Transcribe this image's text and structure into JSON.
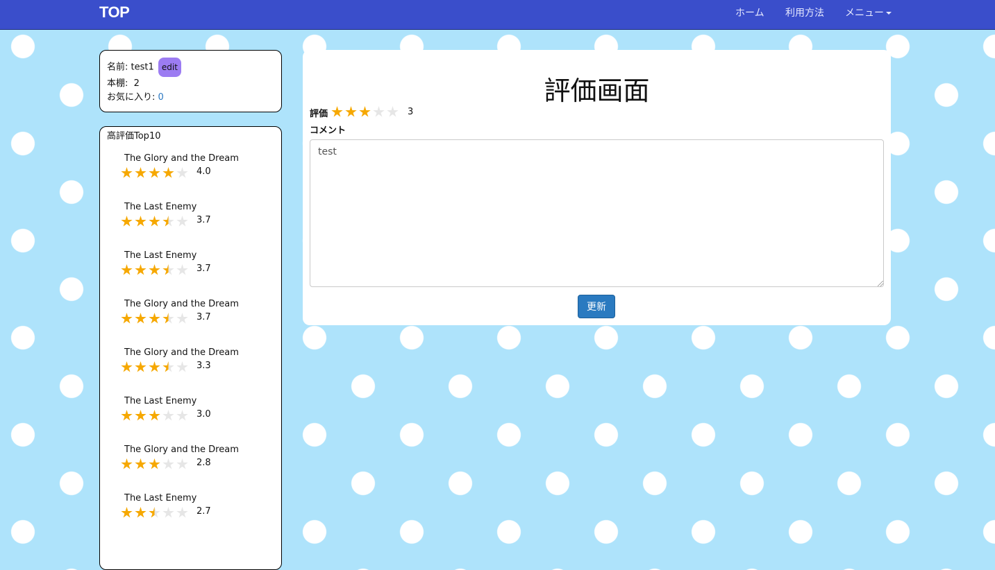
{
  "navbar": {
    "brand": "TOP",
    "links": [
      {
        "label": "ホーム"
      },
      {
        "label": "利用方法"
      },
      {
        "label": "メニュー"
      }
    ]
  },
  "profile": {
    "name_label": "名前: test1",
    "edit_label": "edit",
    "shelf_label": "本棚:  2",
    "favorites_label": "お気に入り: ",
    "favorites_count": "0"
  },
  "ranking": {
    "title": "高評価Top10",
    "items": [
      {
        "title": "The Glory and the Dream",
        "rating": 4.0,
        "score": "4.0"
      },
      {
        "title": "The Last Enemy",
        "rating": 3.5,
        "score": "3.7"
      },
      {
        "title": "The Last Enemy",
        "rating": 3.5,
        "score": "3.7"
      },
      {
        "title": "The Glory and the Dream",
        "rating": 3.5,
        "score": "3.7"
      },
      {
        "title": "The Glory and the Dream",
        "rating": 3.5,
        "score": "3.3"
      },
      {
        "title": "The Last Enemy",
        "rating": 3.0,
        "score": "3.0"
      },
      {
        "title": "The Glory and the Dream",
        "rating": 3.0,
        "score": "2.8"
      },
      {
        "title": "The Last Enemy",
        "rating": 2.5,
        "score": "2.7"
      }
    ]
  },
  "review": {
    "page_title": "評価画面",
    "rating_label": "評価",
    "rating": 3,
    "rating_display": "3",
    "comment_label": "コメント",
    "comment_value": "test",
    "submit_label": "更新"
  },
  "colors": {
    "navbar": "#3a4ecb",
    "background": "#aee3fb",
    "star_on": "#f6a800",
    "star_off": "#e6e6e6",
    "edit_button": "#9c7cf2",
    "submit_button": "#2a7ac0"
  }
}
